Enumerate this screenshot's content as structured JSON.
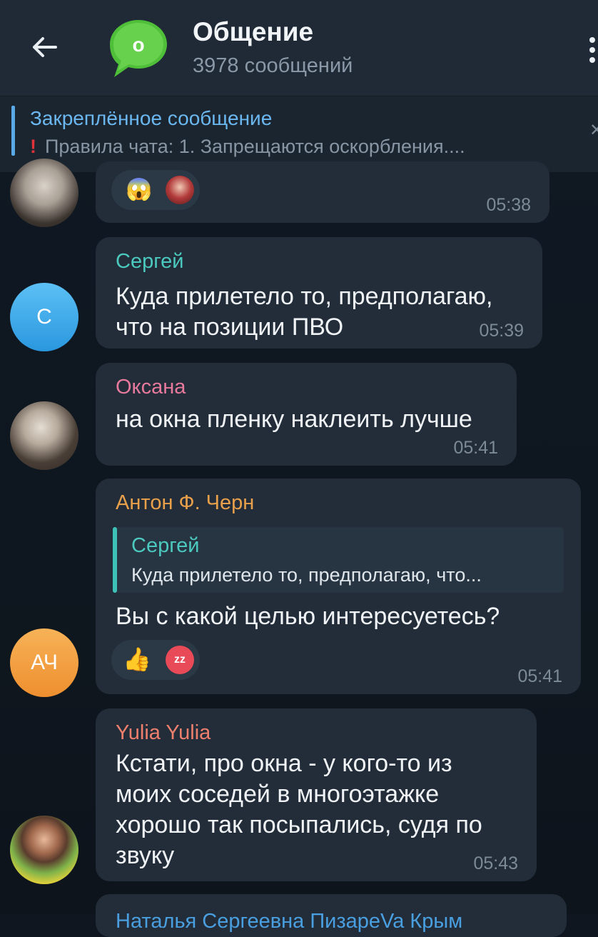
{
  "header": {
    "title": "Общение",
    "subtitle": "3978 сообщений",
    "avatar_letter": "о"
  },
  "pinned": {
    "title": "Закреплённое сообщение",
    "text": "Правила чата:  1. Запрещаются оскорбления...."
  },
  "messages": [
    {
      "time": "05:38"
    },
    {
      "author": "Сергей",
      "avatar_initials": "С",
      "lines": [
        "Куда прилетело то, предполагаю,",
        "что на позиции ПВО"
      ],
      "time": "05:39"
    },
    {
      "author": "Оксана",
      "lines": [
        "на окна пленку наклеить лучше"
      ],
      "time": "05:41"
    },
    {
      "author": "Антон Ф. Черн",
      "avatar_initials": "АЧ",
      "reply": {
        "author": "Сергей",
        "text": "Куда прилетело то, предполагаю, что..."
      },
      "lines": [
        "Вы с какой целью интересуетесь?"
      ],
      "reaction_label": "zz",
      "time": "05:41"
    },
    {
      "author": "Yulia Yulia",
      "lines": [
        "Кстати, про окна - у кого-то из",
        "моих соседей в многоэтажке",
        "хорошо так посыпались, судя по",
        "звуку"
      ],
      "time": "05:43"
    },
    {
      "author": "Наталья Сергеевна ПизареVa Крым"
    }
  ],
  "colors": {
    "accent": "#6bb7ef",
    "sergey": "#4cc9be",
    "oksana": "#e7799c",
    "anton": "#e9a04a",
    "yulia": "#ee7f6d"
  }
}
